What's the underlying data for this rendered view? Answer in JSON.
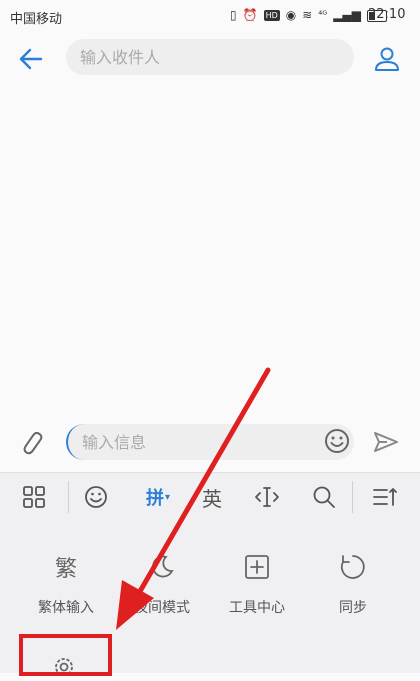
{
  "status_bar": {
    "carrier": "中国移动",
    "time": "22:10",
    "signal": "⁴ᴳ",
    "icons": [
      "vibrate-icon",
      "alarm-icon",
      "hd-icon",
      "eye-icon",
      "wifi-icon",
      "signal-icon",
      "battery-icon"
    ]
  },
  "header": {
    "recipient_placeholder": "输入收件人"
  },
  "compose": {
    "message_placeholder": "输入信息"
  },
  "keyboard_toolbar": {
    "pinyin_label": "拼",
    "english_label": "英"
  },
  "keyboard_panel": {
    "items": [
      {
        "label": "繁体输入",
        "icon_text": "繁"
      },
      {
        "label": "夜间模式"
      },
      {
        "label": "工具中心"
      },
      {
        "label": "同步"
      }
    ]
  },
  "colors": {
    "accent": "#2a7fd7",
    "annotation": "#e02020"
  }
}
